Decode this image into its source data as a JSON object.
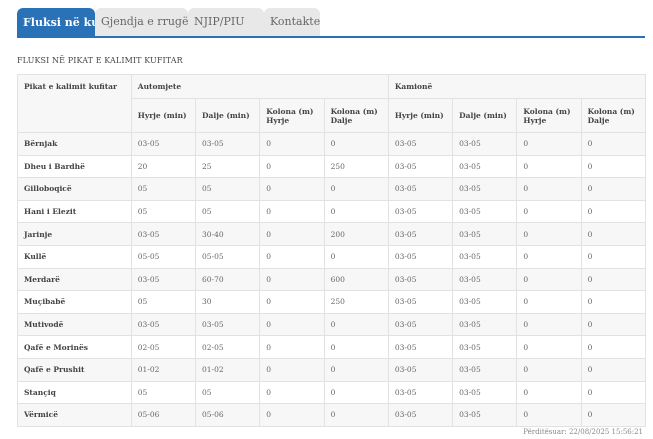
{
  "tabs": [
    {
      "label": "Fluksi në kufi",
      "active": true
    },
    {
      "label": "Gjendja e rrugëve",
      "active": false
    },
    {
      "label": "NJIP/PIU",
      "active": false
    },
    {
      "label": "Kontakte",
      "active": false
    }
  ],
  "section_title": "FLUKSI NË PIKAT E KALIMIT KUFITAR",
  "table": {
    "place_header": "Pikat e kalimit kufitar",
    "group_headers": [
      "Automjete",
      "Kamionë"
    ],
    "sub_headers": [
      "Hyrje (min)",
      "Dalje (min)",
      "Kolona (m) Hyrje",
      "Kolona (m) Dalje",
      "Hyrje (min)",
      "Dalje (min)",
      "Kolona (m) Hyrje",
      "Kolona (m) Dalje"
    ],
    "rows": [
      [
        "Bërnjak",
        "03-05",
        "03-05",
        "0",
        "0",
        "03-05",
        "03-05",
        "0",
        "0"
      ],
      [
        "Dheu i Bardhë",
        "20",
        "25",
        "0",
        "250",
        "03-05",
        "03-05",
        "0",
        "0"
      ],
      [
        "Gilloboqicë",
        "05",
        "05",
        "0",
        "0",
        "03-05",
        "03-05",
        "0",
        "0"
      ],
      [
        "Hani i Elezit",
        "05",
        "05",
        "0",
        "0",
        "03-05",
        "03-05",
        "0",
        "0"
      ],
      [
        "Jarinje",
        "03-05",
        "30-40",
        "0",
        "200",
        "03-05",
        "03-05",
        "0",
        "0"
      ],
      [
        "Kullë",
        "05-05",
        "05-05",
        "0",
        "0",
        "03-05",
        "03-05",
        "0",
        "0"
      ],
      [
        "Merdarë",
        "03-05",
        "60-70",
        "0",
        "600",
        "03-05",
        "03-05",
        "0",
        "0"
      ],
      [
        "Muçibabë",
        "05",
        "30",
        "0",
        "250",
        "03-05",
        "03-05",
        "0",
        "0"
      ],
      [
        "Mutivodë",
        "03-05",
        "03-05",
        "0",
        "0",
        "03-05",
        "03-05",
        "0",
        "0"
      ],
      [
        "Qafë e Morinës",
        "02-05",
        "02-05",
        "0",
        "0",
        "03-05",
        "03-05",
        "0",
        "0"
      ],
      [
        "Qafë e Prushit",
        "01-02",
        "01-02",
        "0",
        "0",
        "03-05",
        "03-05",
        "0",
        "0"
      ],
      [
        "Stançiq",
        "05",
        "05",
        "0",
        "0",
        "03-05",
        "03-05",
        "0",
        "0"
      ],
      [
        "Vërmicë",
        "05-06",
        "05-06",
        "0",
        "0",
        "03-05",
        "03-05",
        "0",
        "0"
      ]
    ]
  },
  "updated": "Përditësuar: 22/08/2025 15:56:21",
  "colors": {
    "accent": "#2a72b8",
    "tab_inactive": "#e8e8e8",
    "row_alt": "#f7f7f7"
  }
}
